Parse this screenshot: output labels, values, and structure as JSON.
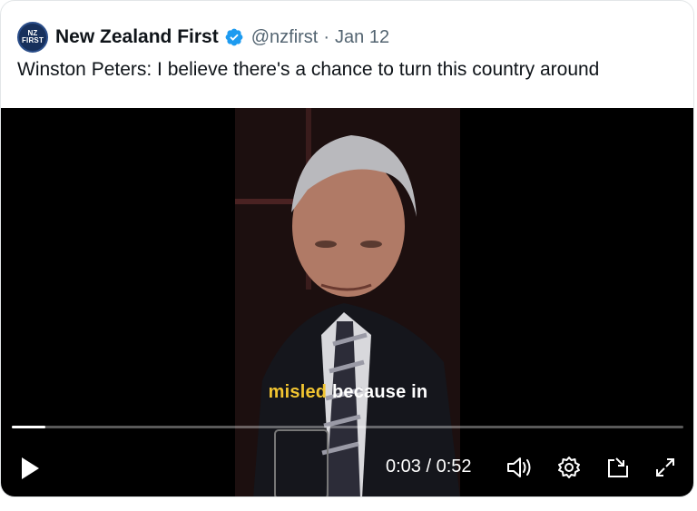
{
  "account": {
    "avatar_text": "NEW ZEALAND FIRST",
    "name": "New Zealand First",
    "verified": true,
    "handle": "@nzfirst",
    "separator": "·",
    "date": "Jan 12"
  },
  "tweet": {
    "text": "Winston Peters: I believe there's a chance to turn this country around"
  },
  "video": {
    "subtitle_highlight": "misled",
    "subtitle_rest": " because in",
    "progress_fraction": 0.05,
    "current_time": "0:03",
    "time_separator": " / ",
    "duration": "0:52",
    "controls": [
      "play-icon",
      "volume-icon",
      "settings-icon",
      "pip-icon",
      "fullscreen-icon"
    ]
  },
  "colors": {
    "verified_badge": "#1d9bf0",
    "subtitle_highlight": "#f2c531",
    "avatar_bg": "#17305c"
  }
}
